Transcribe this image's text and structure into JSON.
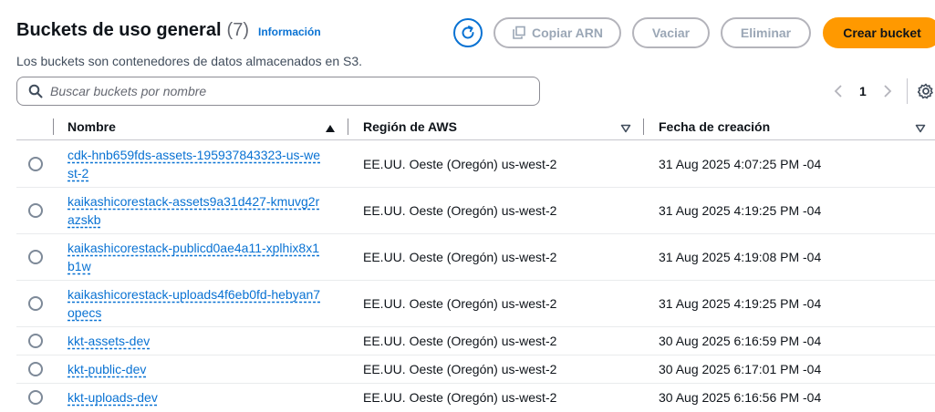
{
  "header": {
    "title": "Buckets de uso general",
    "count": "(7)",
    "info_link": "Información",
    "subtitle": "Los buckets son contenedores de datos almacenados en S3."
  },
  "toolbar": {
    "copy_arn": "Copiar ARN",
    "empty": "Vaciar",
    "delete": "Eliminar",
    "create": "Crear bucket"
  },
  "search": {
    "placeholder": "Buscar buckets por nombre",
    "value": ""
  },
  "pagination": {
    "page": "1"
  },
  "table": {
    "columns": {
      "name": "Nombre",
      "region": "Región de AWS",
      "date": "Fecha de creación"
    },
    "rows": [
      {
        "name": "cdk-hnb659fds-assets-195937843323-us-west-2",
        "region": "EE.UU. Oeste (Oregón) us-west-2",
        "date": "31 Aug 2025 4:07:25 PM -04"
      },
      {
        "name": "kaikashicorestack-assets9a31d427-kmuvg2razskb",
        "region": "EE.UU. Oeste (Oregón) us-west-2",
        "date": "31 Aug 2025 4:19:25 PM -04"
      },
      {
        "name": "kaikashicorestack-publicd0ae4a11-xplhix8x1b1w",
        "region": "EE.UU. Oeste (Oregón) us-west-2",
        "date": "31 Aug 2025 4:19:08 PM -04"
      },
      {
        "name": "kaikashicorestack-uploads4f6eb0fd-hebyan7opecs",
        "region": "EE.UU. Oeste (Oregón) us-west-2",
        "date": "31 Aug 2025 4:19:25 PM -04"
      },
      {
        "name": "kkt-assets-dev",
        "region": "EE.UU. Oeste (Oregón) us-west-2",
        "date": "30 Aug 2025 6:16:59 PM -04"
      },
      {
        "name": "kkt-public-dev",
        "region": "EE.UU. Oeste (Oregón) us-west-2",
        "date": "30 Aug 2025 6:17:01 PM -04"
      },
      {
        "name": "kkt-uploads-dev",
        "region": "EE.UU. Oeste (Oregón) us-west-2",
        "date": "30 Aug 2025 6:16:56 PM -04"
      }
    ]
  },
  "icons": {
    "refresh": "refresh-icon",
    "copy": "copy-icon",
    "search": "search-icon",
    "prev": "chevron-left-icon",
    "next": "chevron-right-icon",
    "settings": "gear-icon",
    "sort_asc": "sort-ascending-icon",
    "sort": "sort-icon"
  },
  "colors": {
    "accent": "#0972d3",
    "primary_button": "#ff9900",
    "disabled_text": "#9ba7b6"
  }
}
